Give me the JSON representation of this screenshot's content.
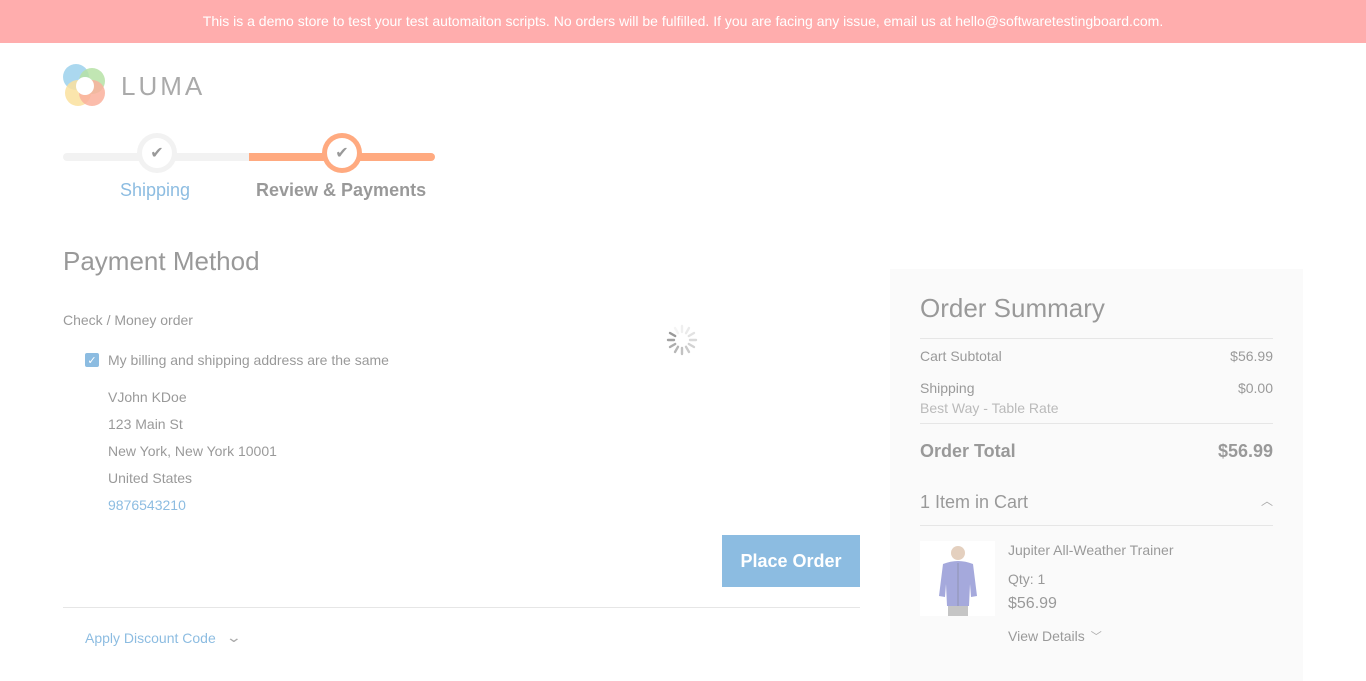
{
  "banner": {
    "text": "This is a demo store to test your test automaiton scripts. No orders will be fulfilled. If you are facing any issue, email us at hello@softwaretestingboard.com."
  },
  "logo": {
    "text": "LUMA"
  },
  "progress": {
    "steps": [
      {
        "label": "Shipping",
        "state": "complete"
      },
      {
        "label": "Review & Payments",
        "state": "active"
      }
    ]
  },
  "payment": {
    "title": "Payment Method",
    "method_label": "Check / Money order",
    "same_address_label": "My billing and shipping address are the same",
    "same_address_checked": true,
    "address": {
      "name": "VJohn KDoe",
      "street": "123 Main St",
      "city_line": "New York, New York 10001",
      "country": "United States",
      "phone": "9876543210"
    },
    "place_order_label": "Place Order",
    "discount_label": "Apply Discount Code"
  },
  "summary": {
    "title": "Order Summary",
    "cart_subtotal_label": "Cart Subtotal",
    "cart_subtotal_value": "$56.99",
    "shipping_label": "Shipping",
    "shipping_value": "$0.00",
    "shipping_method": "Best Way - Table Rate",
    "order_total_label": "Order Total",
    "order_total_value": "$56.99",
    "items_header": "1 Item in Cart",
    "item": {
      "name": "Jupiter All-Weather Trainer",
      "qty": "Qty: 1",
      "price": "$56.99",
      "view_details": "View Details"
    }
  },
  "colors": {
    "banner": "#ff5b5b",
    "accent": "#ff5501",
    "link": "#1979c3",
    "summary_bg": "#f5f5f5"
  }
}
